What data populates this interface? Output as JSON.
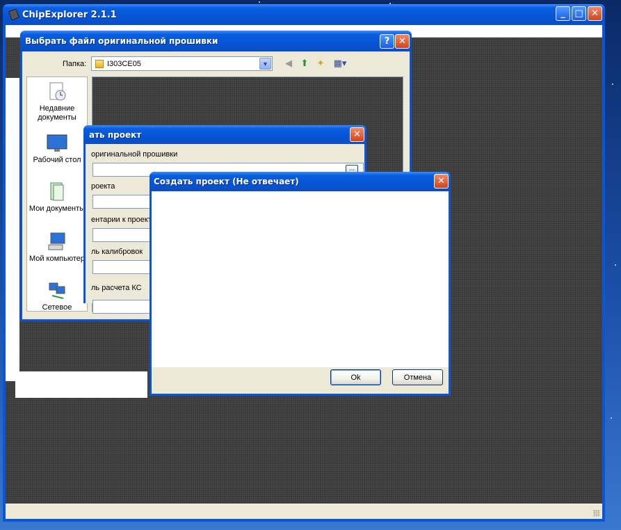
{
  "app": {
    "title": "ChipExplorer 2.1.1",
    "buttons": {
      "minimize": "_",
      "maximize": "□",
      "close": "✕"
    }
  },
  "open_dialog": {
    "title": "Выбрать файл оригинальной прошивки",
    "help": "?",
    "close": "✕",
    "folder_label": "Папка:",
    "folder_value": "I303CE05",
    "places": [
      {
        "label": "Недавние документы",
        "icon": "recent-documents-icon"
      },
      {
        "label": "Рабочий стол",
        "icon": "desktop-icon"
      },
      {
        "label": "Мои документы",
        "icon": "my-documents-icon"
      },
      {
        "label": "Мой компьютер",
        "icon": "my-computer-icon"
      },
      {
        "label": "Сетевое",
        "icon": "network-icon"
      }
    ]
  },
  "create_dialog": {
    "title_visible": "ать проект",
    "close": "✕",
    "fields": [
      {
        "label": "оригинальной прошивки"
      },
      {
        "label": "роекта"
      },
      {
        "label": "ентарии к проект"
      },
      {
        "label": "ль калибровок"
      },
      {
        "label": "ль расчета КС"
      }
    ],
    "browse": "..."
  },
  "hung_dialog": {
    "title": "Создать проект (Не отвечает)",
    "close": "✕",
    "ok_label": "Ok",
    "cancel_label": "Отмена"
  }
}
